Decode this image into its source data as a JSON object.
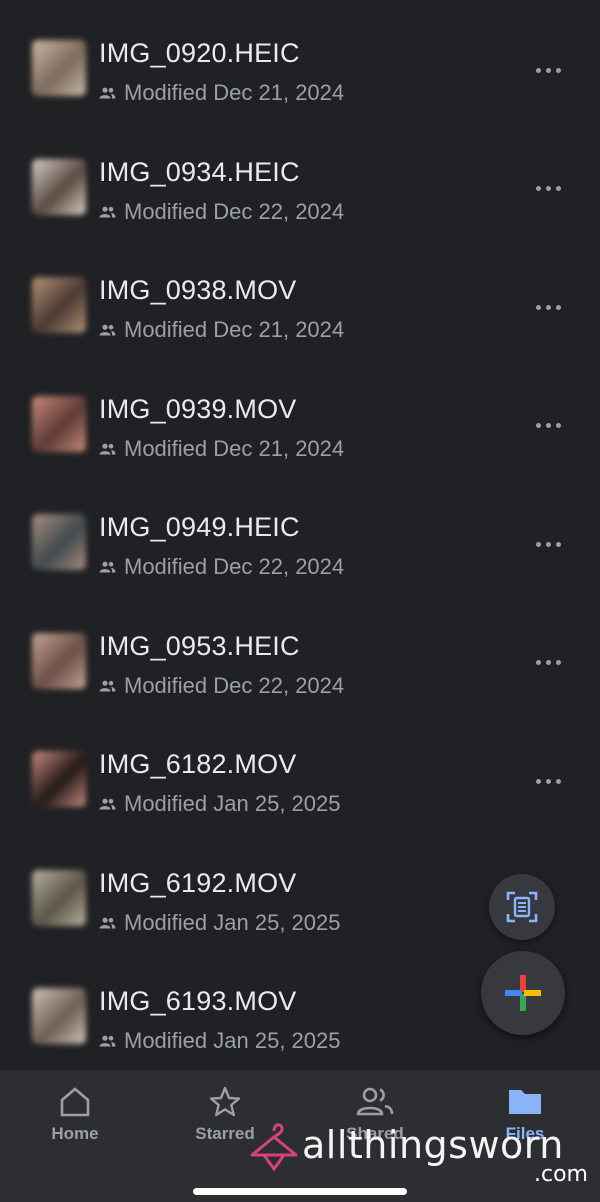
{
  "files": [
    {
      "name": "IMG_0920.HEIC",
      "meta": "Modified Dec 21, 2024",
      "thumb": [
        "#c9b8a6",
        "#7d6a5c"
      ]
    },
    {
      "name": "IMG_0934.HEIC",
      "meta": "Modified Dec 22, 2024",
      "thumb": [
        "#d8cfc5",
        "#5a4a42"
      ]
    },
    {
      "name": "IMG_0938.MOV",
      "meta": "Modified Dec 21, 2024",
      "thumb": [
        "#b39276",
        "#4b3a33"
      ]
    },
    {
      "name": "IMG_0939.MOV",
      "meta": "Modified Dec 21, 2024",
      "thumb": [
        "#c98a7a",
        "#5e3b37"
      ]
    },
    {
      "name": "IMG_0949.HEIC",
      "meta": "Modified Dec 22, 2024",
      "thumb": [
        "#a98f80",
        "#3f4a4c"
      ]
    },
    {
      "name": "IMG_0953.HEIC",
      "meta": "Modified Dec 22, 2024",
      "thumb": [
        "#c7a494",
        "#6b5048"
      ]
    },
    {
      "name": "IMG_6182.MOV",
      "meta": "Modified Jan 25, 2025",
      "thumb": [
        "#c58a80",
        "#231917"
      ]
    },
    {
      "name": "IMG_6192.MOV",
      "meta": "Modified Jan 25, 2025",
      "thumb": [
        "#b6b09b",
        "#5c5649"
      ]
    },
    {
      "name": "IMG_6193.MOV",
      "meta": "Modified Jan 25, 2025",
      "thumb": [
        "#cfc3b5",
        "#6d5f54"
      ]
    }
  ],
  "icons": {
    "shared": "people-icon",
    "more": "more-horiz-icon",
    "scan": "document-scan-icon",
    "new": "google-plus-icon"
  },
  "nav": {
    "home": "Home",
    "starred": "Starred",
    "shared": "Shared",
    "files": "Files"
  },
  "watermark": {
    "text": "allthingsworn",
    "suffix": ".com"
  },
  "colors": {
    "background": "#202124",
    "nav_background": "#2d2e31",
    "active": "#8ab4f8",
    "muted": "#9aa0a6"
  }
}
